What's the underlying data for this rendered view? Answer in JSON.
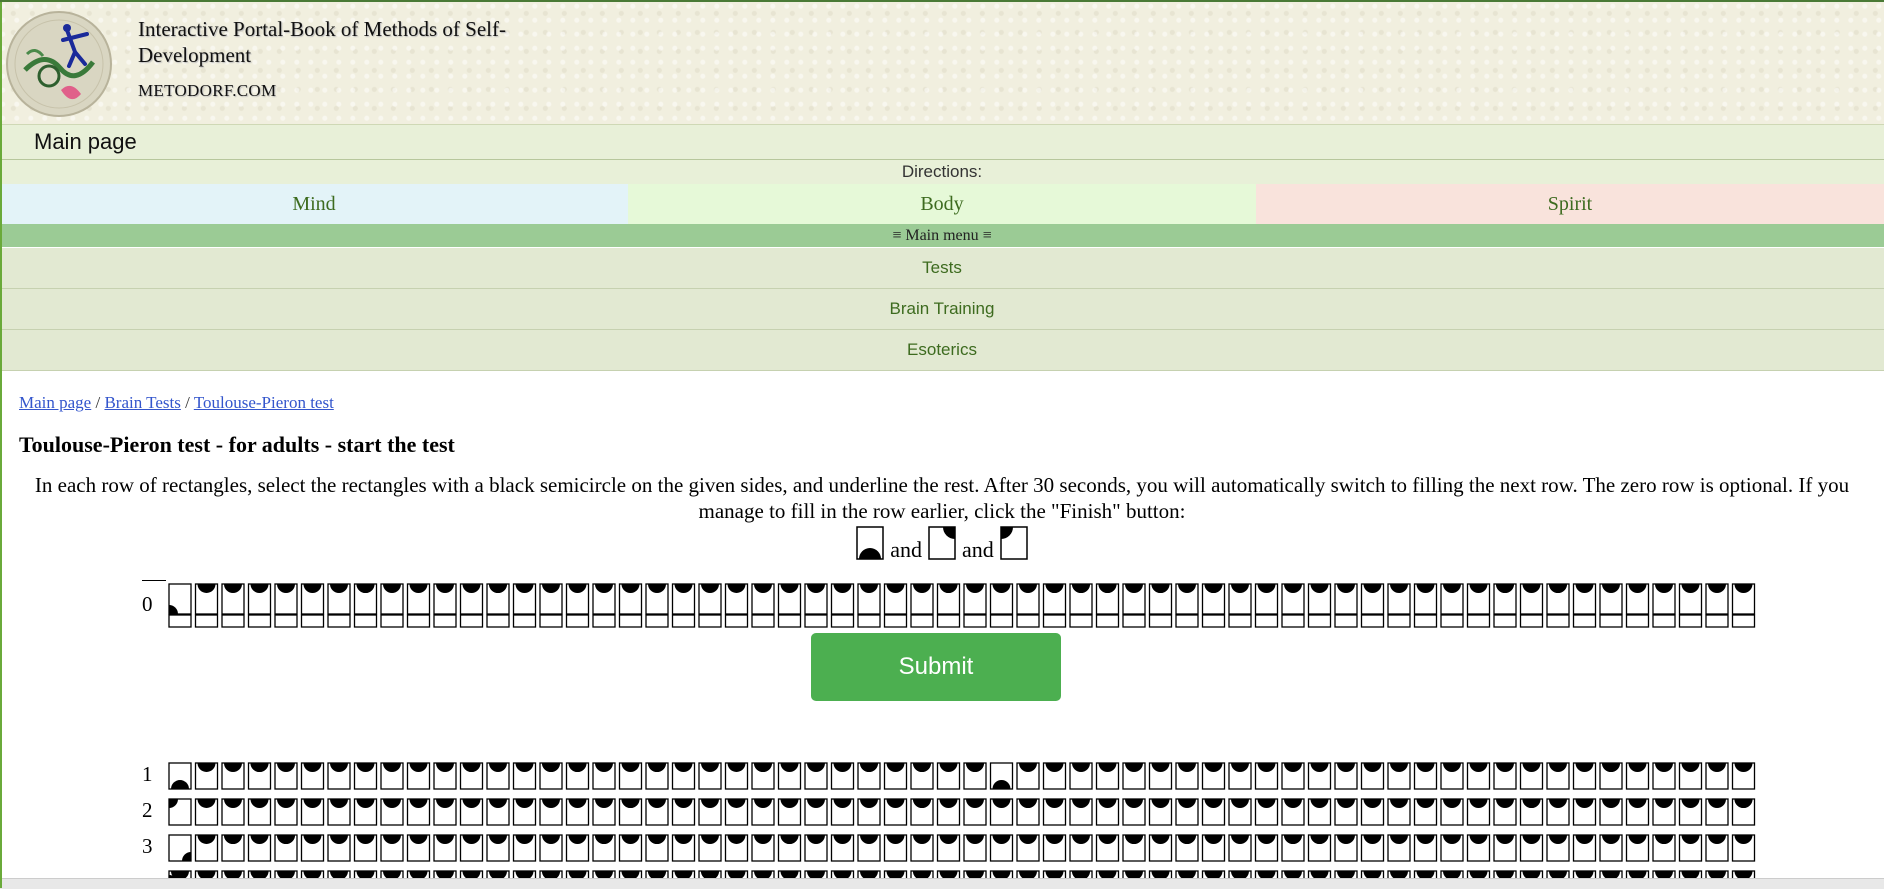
{
  "header": {
    "title": "Interactive Portal-Book of Methods of Self-Development",
    "domain": "METODORF.COM"
  },
  "nav": {
    "main_page": "Main page",
    "directions_label": "Directions:",
    "directions": [
      "Mind",
      "Body",
      "Spirit"
    ],
    "main_menu": "≡ Main menu ≡",
    "menu_items": [
      "Tests",
      "Brain Training",
      "Esoterics"
    ]
  },
  "breadcrumb": {
    "items": [
      "Main page",
      "Brain Tests",
      "Toulouse-Pieron test"
    ],
    "separator": " / "
  },
  "content": {
    "title": "Toulouse-Pieron test - for adults - start the test",
    "instructions": "In each row of rectangles, select the rectangles with a black semicircle on the given sides, and underline the rest. After 30 seconds, you will automatically switch to filling the next row. The zero row is optional. If you manage to fill in the row earlier, click the \"Finish\" button:",
    "and_word": "and",
    "target_samples": [
      "bottom",
      "top-right",
      "top-left"
    ]
  },
  "test": {
    "row_labels": [
      "0",
      "1",
      "2",
      "3"
    ],
    "submit_label": "Submit"
  },
  "colors": {
    "accent_green": "#4caf50",
    "link": "#3355cc",
    "nav_text": "#3d6b1f"
  }
}
